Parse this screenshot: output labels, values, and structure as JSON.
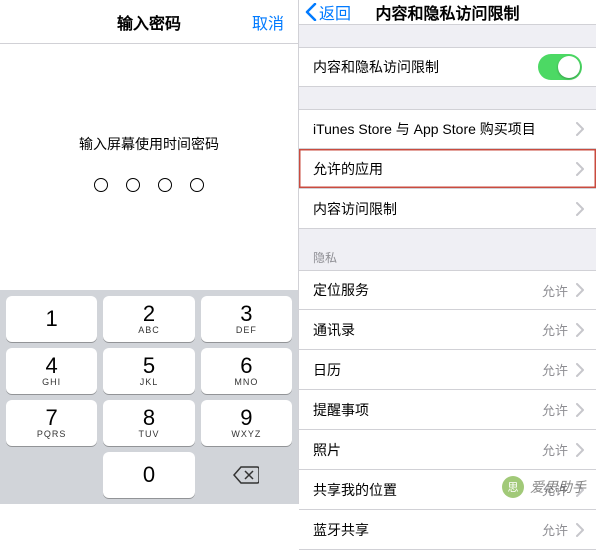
{
  "left": {
    "nav_title": "输入密码",
    "cancel": "取消",
    "prompt": "输入屏幕使用时间密码",
    "keys": [
      {
        "num": "1",
        "letters": ""
      },
      {
        "num": "2",
        "letters": "ABC"
      },
      {
        "num": "3",
        "letters": "DEF"
      },
      {
        "num": "4",
        "letters": "GHI"
      },
      {
        "num": "5",
        "letters": "JKL"
      },
      {
        "num": "6",
        "letters": "MNO"
      },
      {
        "num": "7",
        "letters": "PQRS"
      },
      {
        "num": "8",
        "letters": "TUV"
      },
      {
        "num": "9",
        "letters": "WXYZ"
      },
      {
        "num": "0",
        "letters": ""
      }
    ]
  },
  "right": {
    "back": "返回",
    "nav_title": "内容和隐私访问限制",
    "master_toggle_label": "内容和隐私访问限制",
    "cells1": [
      {
        "label": "iTunes Store 与 App Store 购买项目"
      },
      {
        "label": "允许的应用",
        "highlight": true
      },
      {
        "label": "内容访问限制"
      }
    ],
    "privacy_header": "隐私",
    "cells2": [
      {
        "label": "定位服务",
        "value": "允许"
      },
      {
        "label": "通讯录",
        "value": "允许"
      },
      {
        "label": "日历",
        "value": "允许"
      },
      {
        "label": "提醒事项",
        "value": "允许"
      },
      {
        "label": "照片",
        "value": "允许"
      },
      {
        "label": "共享我的位置",
        "value": "允许"
      },
      {
        "label": "蓝牙共享",
        "value": "允许"
      }
    ]
  },
  "watermark": "爱思助手"
}
